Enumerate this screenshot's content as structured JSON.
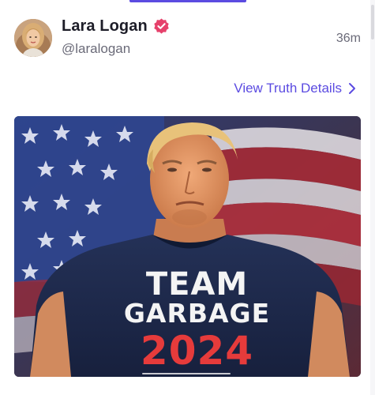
{
  "post": {
    "author": {
      "display_name": "Lara Logan",
      "handle": "@laralogan",
      "verified": true,
      "avatar_icon": "avatar-photo"
    },
    "timestamp": "36m",
    "details_link": {
      "label": "View Truth Details",
      "icon": "chevron-right-icon"
    },
    "media": {
      "shirt_text": {
        "line1": "TEAM",
        "line2": "GARBAGE",
        "line3": "2024"
      }
    }
  },
  "colors": {
    "accent": "#5b4be1",
    "verified_badge": "#e6416b",
    "text_primary": "#1d1d28",
    "text_secondary": "#6a6a78",
    "shirt_navy": "#1e2a4a",
    "shirt_red_text": "#e63b3b"
  }
}
